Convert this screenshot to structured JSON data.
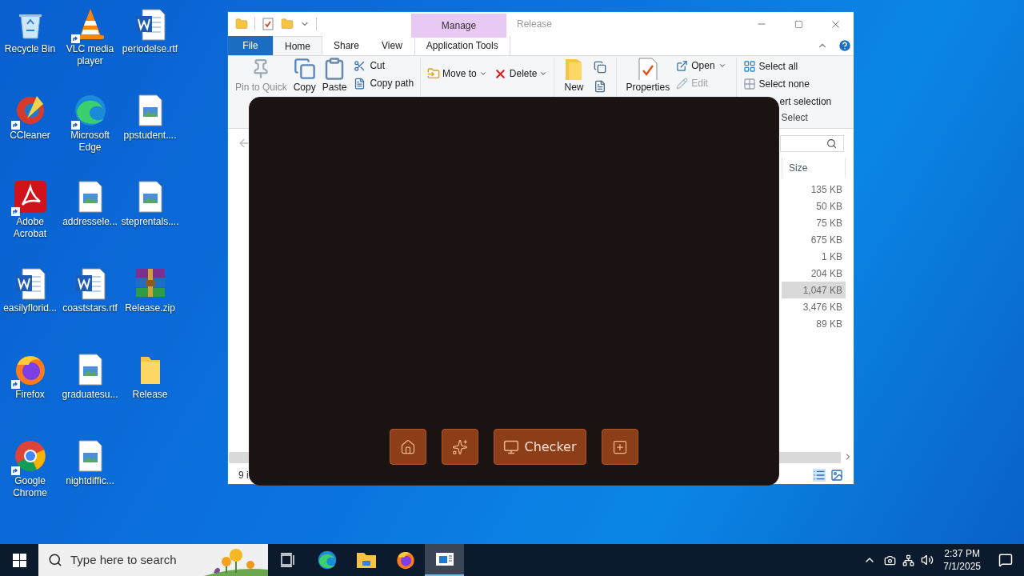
{
  "desktop_icons": [
    {
      "kind": "recycle",
      "label": "Recycle Bin",
      "shortcut": false
    },
    {
      "kind": "ccleaner",
      "label": "CCleaner",
      "shortcut": true
    },
    {
      "kind": "acrobat",
      "label": "Adobe Acrobat",
      "shortcut": true
    },
    {
      "kind": "word",
      "label": "easilyflorid...",
      "shortcut": false
    },
    {
      "kind": "firefox",
      "label": "Firefox",
      "shortcut": true
    },
    {
      "kind": "chrome",
      "label": "Google Chrome",
      "shortcut": true
    },
    {
      "kind": "vlc",
      "label": "VLC media player",
      "shortcut": true
    },
    {
      "kind": "edge",
      "label": "Microsoft Edge",
      "shortcut": true
    },
    {
      "kind": "image",
      "label": "addressele...",
      "shortcut": false
    },
    {
      "kind": "word",
      "label": "coaststars.rtf",
      "shortcut": false
    },
    {
      "kind": "image",
      "label": "graduatesu...",
      "shortcut": false
    },
    {
      "kind": "image",
      "label": "nightdiffic...",
      "shortcut": false
    },
    {
      "kind": "word",
      "label": "periodelse.rtf",
      "shortcut": false
    },
    {
      "kind": "image",
      "label": "ppstudent....",
      "shortcut": false
    },
    {
      "kind": "image",
      "label": "steprentals....",
      "shortcut": false
    },
    {
      "kind": "winrar",
      "label": "Release.zip",
      "shortcut": false
    },
    {
      "kind": "folder",
      "label": "Release",
      "shortcut": false
    }
  ],
  "explorer": {
    "context_tab": "Manage",
    "title": "Release",
    "tabs": [
      {
        "label": "File",
        "kind": "file",
        "selected": false
      },
      {
        "label": "Home",
        "kind": "tab",
        "selected": true
      },
      {
        "label": "Share",
        "kind": "tab",
        "selected": false
      },
      {
        "label": "View",
        "kind": "tab",
        "selected": false
      },
      {
        "label": "Application Tools",
        "kind": "tab",
        "selected": false
      }
    ],
    "clipboard": {
      "large": [
        {
          "kind": "pin",
          "label": "Pin to Quick",
          "disabled": true
        },
        {
          "kind": "copy",
          "label": "Copy",
          "disabled": false
        },
        {
          "kind": "paste",
          "label": "Paste",
          "disabled": false
        }
      ],
      "small": [
        {
          "kind": "cut",
          "label": "Cut"
        },
        {
          "kind": "copypath",
          "label": "Copy path"
        }
      ]
    },
    "organize": [
      {
        "kind": "move",
        "label": "Move to"
      },
      {
        "kind": "delete",
        "label": "Delete"
      }
    ],
    "new": {
      "label": "New"
    },
    "open": {
      "large": {
        "label": "Properties"
      },
      "small": [
        {
          "kind": "open",
          "label": "Open",
          "dropdown": true,
          "disabled": false
        },
        {
          "kind": "edit",
          "label": "Edit",
          "dropdown": false,
          "disabled": true
        }
      ]
    },
    "select": {
      "items": [
        {
          "kind": "all",
          "label": "Select all"
        },
        {
          "kind": "none",
          "label": "Select none"
        },
        {
          "kind": "invert",
          "label": "ert selection"
        }
      ],
      "group_label": "Select"
    },
    "size_header": "Size",
    "rows": [
      {
        "size": "135 KB",
        "selected": false
      },
      {
        "size": "50 KB",
        "selected": false
      },
      {
        "size": "75 KB",
        "selected": false
      },
      {
        "size": "675 KB",
        "selected": false
      },
      {
        "size": "1 KB",
        "selected": false
      },
      {
        "size": "204 KB",
        "selected": false
      },
      {
        "size": "1,047 KB",
        "selected": true
      },
      {
        "size": "3,476 KB",
        "selected": false
      },
      {
        "size": "89 KB",
        "selected": false
      }
    ],
    "status": "9 i"
  },
  "overlay": {
    "buttons": [
      {
        "kind": "home"
      },
      {
        "kind": "sparkles"
      },
      {
        "kind": "monitor",
        "label": "Checker"
      },
      {
        "kind": "plus"
      }
    ]
  },
  "taskbar": {
    "search_placeholder": "Type here to search",
    "apps": [
      {
        "kind": "taskview",
        "active": false
      },
      {
        "kind": "edge",
        "active": false
      },
      {
        "kind": "explorer",
        "active": false
      },
      {
        "kind": "firefox",
        "active": false
      },
      {
        "kind": "window",
        "active": true
      }
    ],
    "time": "2:37 PM",
    "date": "7/1/2025"
  }
}
